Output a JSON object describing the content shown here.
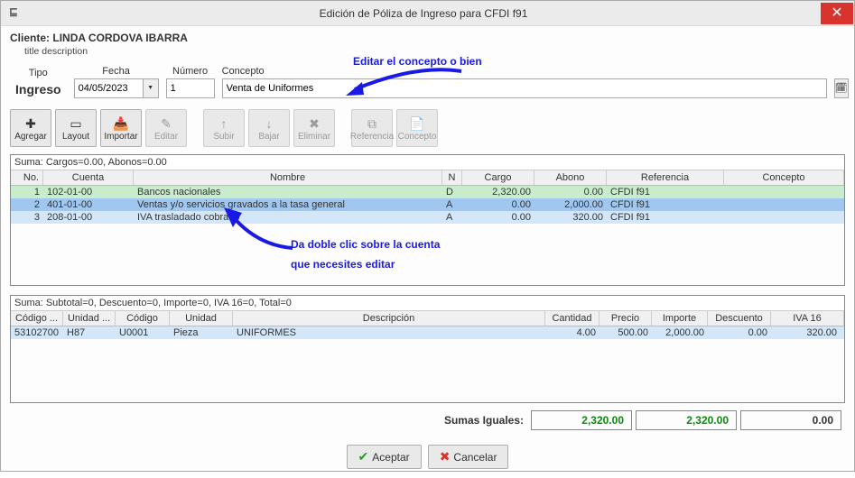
{
  "window": {
    "title": "Edición de Póliza de Ingreso para CFDI f91"
  },
  "client": {
    "label": "Cliente:",
    "name": "LINDA CORDOVA IBARRA",
    "subtitle": "title description"
  },
  "annotations": {
    "edit_concept": "Editar el concepto o bien",
    "dbl_click_1": "Da doble clic sobre la cuenta",
    "dbl_click_2": "que necesites editar"
  },
  "form": {
    "tipo_lbl": "Tipo",
    "tipo_val": "Ingreso",
    "fecha_lbl": "Fecha",
    "fecha_val": "04/05/2023",
    "numero_lbl": "Número",
    "numero_val": "1",
    "concepto_lbl": "Concepto",
    "concepto_val": "Venta de Uniformes"
  },
  "toolbar": {
    "agregar": "Agregar",
    "layout": "Layout",
    "importar": "Importar",
    "editar": "Editar",
    "subir": "Subir",
    "bajar": "Bajar",
    "eliminar": "Eliminar",
    "referencia": "Referencia",
    "concepto": "Concepto"
  },
  "grid1": {
    "suma": "Suma:  Cargos=0.00, Abonos=0.00",
    "headers": {
      "no": "No.",
      "cuenta": "Cuenta",
      "nombre": "Nombre",
      "n": "N",
      "cargo": "Cargo",
      "abono": "Abono",
      "ref": "Referencia",
      "conc": "Concepto"
    },
    "rows": [
      {
        "no": "1",
        "cuenta": "102-01-00",
        "nombre": "Bancos nacionales",
        "n": "D",
        "cargo": "2,320.00",
        "abono": "0.00",
        "ref": "CFDI f91",
        "conc": ""
      },
      {
        "no": "2",
        "cuenta": "401-01-00",
        "nombre": "Ventas y/o servicios gravados a la tasa general",
        "n": "A",
        "cargo": "0.00",
        "abono": "2,000.00",
        "ref": "CFDI f91",
        "conc": ""
      },
      {
        "no": "3",
        "cuenta": "208-01-00",
        "nombre": "IVA trasladado cobrado",
        "n": "A",
        "cargo": "0.00",
        "abono": "320.00",
        "ref": "CFDI f91",
        "conc": ""
      }
    ]
  },
  "grid2": {
    "suma": "Suma:  Subtotal=0, Descuento=0, Importe=0, IVA 16=0, Total=0",
    "headers": {
      "codigo": "Código ...",
      "unidad": "Unidad ...",
      "cod2": "Código",
      "uni2": "Unidad",
      "desc": "Descripción",
      "cant": "Cantidad",
      "precio": "Precio",
      "imp": "Importe",
      "descu": "Descuento",
      "iva": "IVA 16"
    },
    "rows": [
      {
        "codigo": "53102700",
        "unidad": "H87",
        "cod2": "U0001",
        "uni2": "Pieza",
        "desc": "UNIFORMES",
        "cant": "4.00",
        "precio": "500.00",
        "imp": "2,000.00",
        "descu": "0.00",
        "iva": "320.00"
      }
    ]
  },
  "totals": {
    "label": "Sumas Iguales:",
    "cargos": "2,320.00",
    "abonos": "2,320.00",
    "diff": "0.00"
  },
  "buttons": {
    "ok": "Aceptar",
    "cancel": "Cancelar"
  }
}
